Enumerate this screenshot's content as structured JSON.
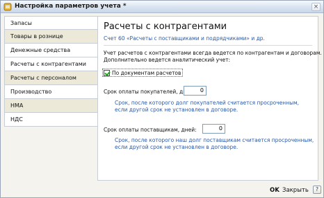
{
  "window": {
    "title": "Настройка параметров учета *",
    "close_glyph": "×"
  },
  "sidebar": {
    "items": [
      {
        "label": "Запасы"
      },
      {
        "label": "Товары в рознице"
      },
      {
        "label": "Денежные средства"
      },
      {
        "label": "Расчеты с контрагентами"
      },
      {
        "label": "Расчеты с персоналом"
      },
      {
        "label": "Производство"
      },
      {
        "label": "НМА"
      },
      {
        "label": "НДС"
      }
    ],
    "active_index": 3
  },
  "main": {
    "heading": "Расчеты с контрагентами",
    "subtitle": "Счет 60 «Расчеты с поставщиками и подрядчиками» и др.",
    "description_line1": "Учет расчетов с контрагентами всегда ведется по контрагентам и договорам.",
    "description_line2": "Дополнительно ведется аналитический учет:",
    "checkbox": {
      "label": "По документам расчетов",
      "checked": true
    },
    "buyers": {
      "label": "Срок оплаты покупателей, дней:",
      "value": "0",
      "hint_line1": "Срок, после которого долг покупателей считается просроченным,",
      "hint_line2": "если другой срок не установлен в договоре."
    },
    "suppliers": {
      "label": "Срок оплаты поставщикам, дней:",
      "value": "0",
      "hint_line1": "Срок, после которого наш долг поставщикам считается просроченным,",
      "hint_line2": "если другой срок не установлен в договоре."
    }
  },
  "footer": {
    "ok_label": "OK",
    "close_label": "Закрыть",
    "help_label": "?"
  },
  "colors": {
    "accent_blue_text": "#2a5aa8",
    "checkmark_green": "#21a121"
  }
}
